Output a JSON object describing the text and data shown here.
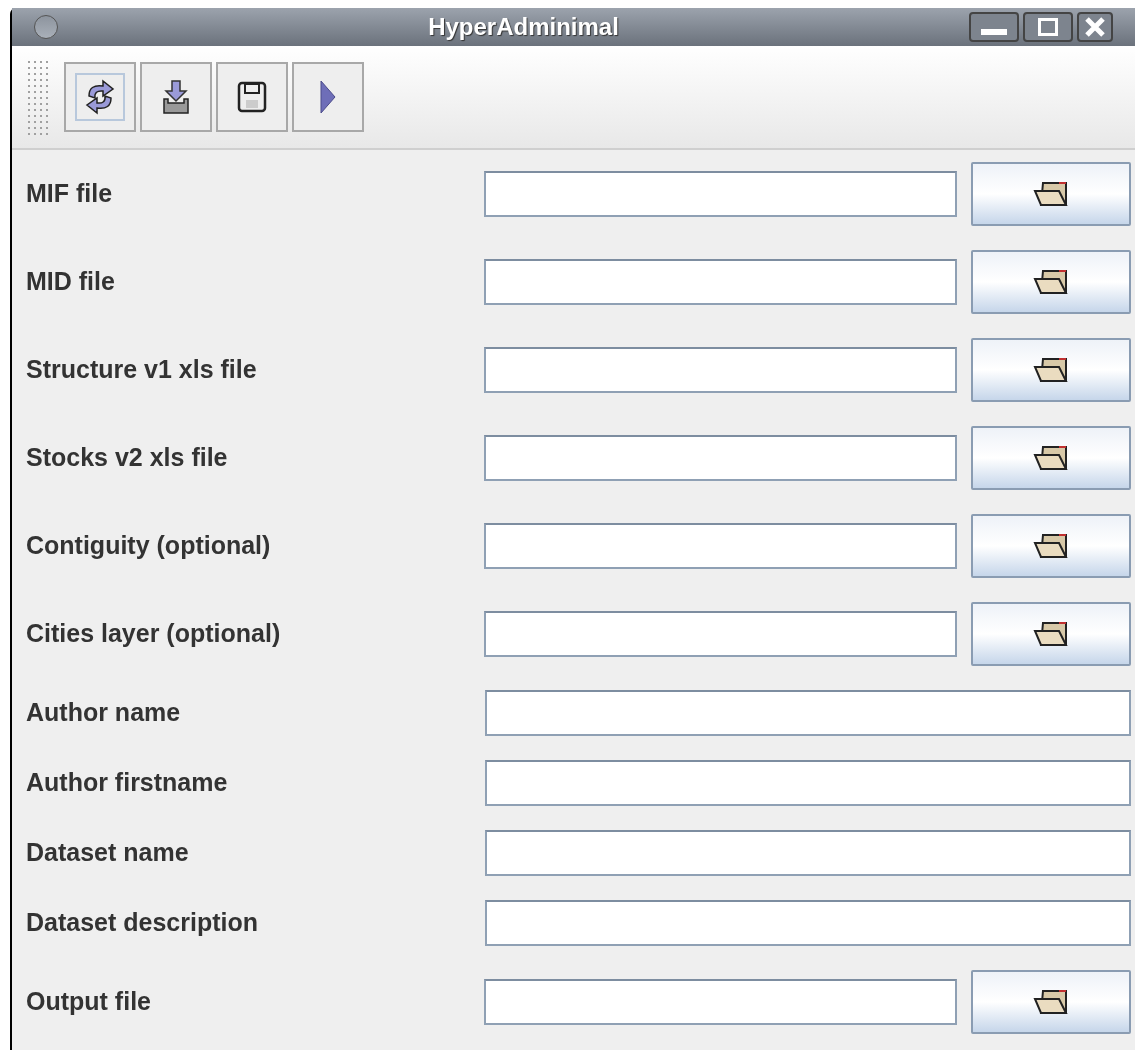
{
  "window": {
    "title": "HyperAdminimal"
  },
  "toolbar": [
    {
      "kind": "refresh",
      "focused": true
    },
    {
      "kind": "import",
      "focused": false
    },
    {
      "kind": "save",
      "focused": false
    },
    {
      "kind": "run",
      "focused": false
    }
  ],
  "form": [
    {
      "kind": "file",
      "label": "MIF file"
    },
    {
      "kind": "file",
      "label": "MID file"
    },
    {
      "kind": "file",
      "label": "Structure v1 xls file"
    },
    {
      "kind": "file",
      "label": "Stocks v2 xls file"
    },
    {
      "kind": "file",
      "label": "Contiguity (optional)"
    },
    {
      "kind": "file",
      "label": "Cities layer (optional)"
    },
    {
      "kind": "text",
      "label": "Author name"
    },
    {
      "kind": "text",
      "label": "Author firstname"
    },
    {
      "kind": "text",
      "label": "Dataset name"
    },
    {
      "kind": "text",
      "label": "Dataset description"
    },
    {
      "kind": "file",
      "label": "Output file"
    }
  ]
}
